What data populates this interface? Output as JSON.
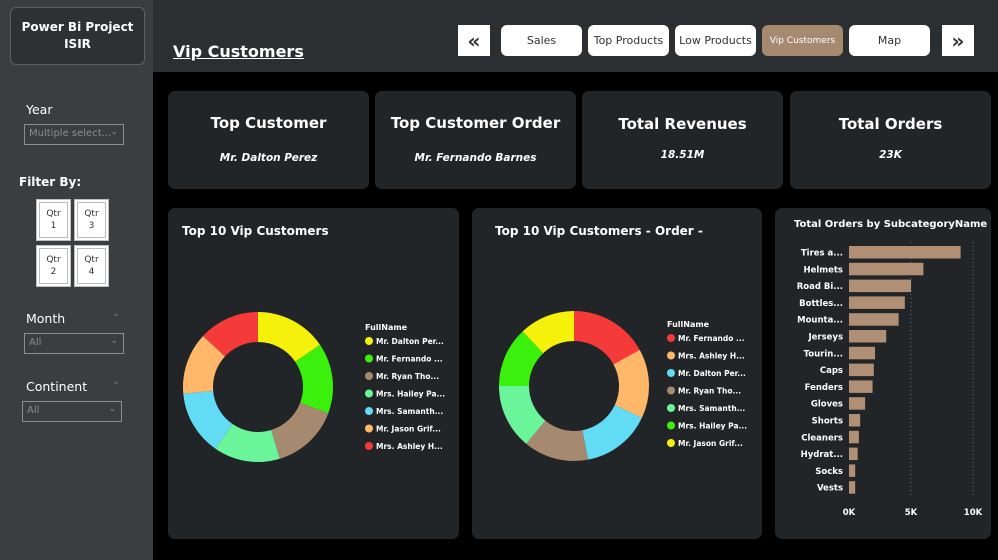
{
  "sidebar": {
    "project_title_line1": "Power Bi Project",
    "project_title_line2": "ISIR",
    "year_label": "Year",
    "year_value": "Multiple select...",
    "filter_by_label": "Filter By:",
    "qtr_buttons": [
      {
        "line1": "Qtr",
        "line2": "1"
      },
      {
        "line1": "Qtr",
        "line2": "3"
      },
      {
        "line1": "Qtr",
        "line2": "2"
      },
      {
        "line1": "Qtr",
        "line2": "4"
      }
    ],
    "month_label": "Month",
    "month_value": "All",
    "continent_label": "Continent",
    "continent_value": "All"
  },
  "header": {
    "page_title": "Vip Customers",
    "nav": [
      "Sales",
      "Top Products",
      "Low Products",
      "Vip Customers",
      "Map"
    ],
    "active_nav": "Vip Customers",
    "prev_icon": "double-chevron-left",
    "next_icon": "double-chevron-right"
  },
  "kpis": [
    {
      "title": "Top Customer",
      "value": "Mr. Dalton Perez"
    },
    {
      "title": "Top Customer Order",
      "value": "Mr. Fernando Barnes"
    },
    {
      "title": "Total Revenues",
      "value": "18.51M"
    },
    {
      "title": "Total Orders",
      "value": "23K"
    }
  ],
  "chart_data": [
    {
      "type": "donut",
      "title": "Top 10 Vip Customers",
      "legend_title": "FullName",
      "legend": [
        {
          "label": "Mr. Dalton Per...",
          "color": "#f5f10a"
        },
        {
          "label": "Mr. Fernando ...",
          "color": "#3cf00d"
        },
        {
          "label": "Mr. Ryan Tho...",
          "color": "#a68a70"
        },
        {
          "label": "Mrs. Hailey Pa...",
          "color": "#6af59a"
        },
        {
          "label": "Mrs. Samanth...",
          "color": "#62dbf5"
        },
        {
          "label": "Mr. Jason Grif...",
          "color": "#ffb769"
        },
        {
          "label": "Mrs. Ashley H...",
          "color": "#f53a3a"
        }
      ],
      "values": [
        15.5,
        15.2,
        14.6,
        14.3,
        14.0,
        13.3,
        13.1
      ]
    },
    {
      "type": "donut",
      "title": "Top 10 Vip Customers - Order -",
      "legend_title": "FullName",
      "legend": [
        {
          "label": "Mr. Fernando ...",
          "color": "#f53a3a"
        },
        {
          "label": "Mrs. Ashley H...",
          "color": "#ffb769"
        },
        {
          "label": "Mr. Dalton Per...",
          "color": "#62dbf5"
        },
        {
          "label": "Mr. Ryan Tho...",
          "color": "#a68a70"
        },
        {
          "label": "Mrs. Samanth...",
          "color": "#6af59a"
        },
        {
          "label": "Mrs. Hailey Pa...",
          "color": "#3cf00d"
        },
        {
          "label": "Mr. Jason Grif...",
          "color": "#f5f10a"
        }
      ],
      "values": [
        17,
        15,
        15,
        14,
        14,
        13,
        12
      ]
    },
    {
      "type": "bar",
      "orientation": "horizontal",
      "title": "Total Orders by SubcategoryName",
      "categories": [
        "Tires a...",
        "Helmets",
        "Road Bi...",
        "Bottles...",
        "Mounta...",
        "Jerseys",
        "Tourin...",
        "Caps",
        "Fenders",
        "Gloves",
        "Shorts",
        "Cleaners",
        "Hydrat...",
        "Socks",
        "Vests"
      ],
      "values": [
        9000,
        6000,
        5000,
        4500,
        4000,
        3000,
        2100,
        2000,
        1900,
        1300,
        900,
        800,
        700,
        500,
        500
      ],
      "xticks": [
        "0K",
        "5K",
        "10K"
      ],
      "xlim": [
        0,
        10000
      ],
      "bar_color": "#b08f74"
    }
  ]
}
